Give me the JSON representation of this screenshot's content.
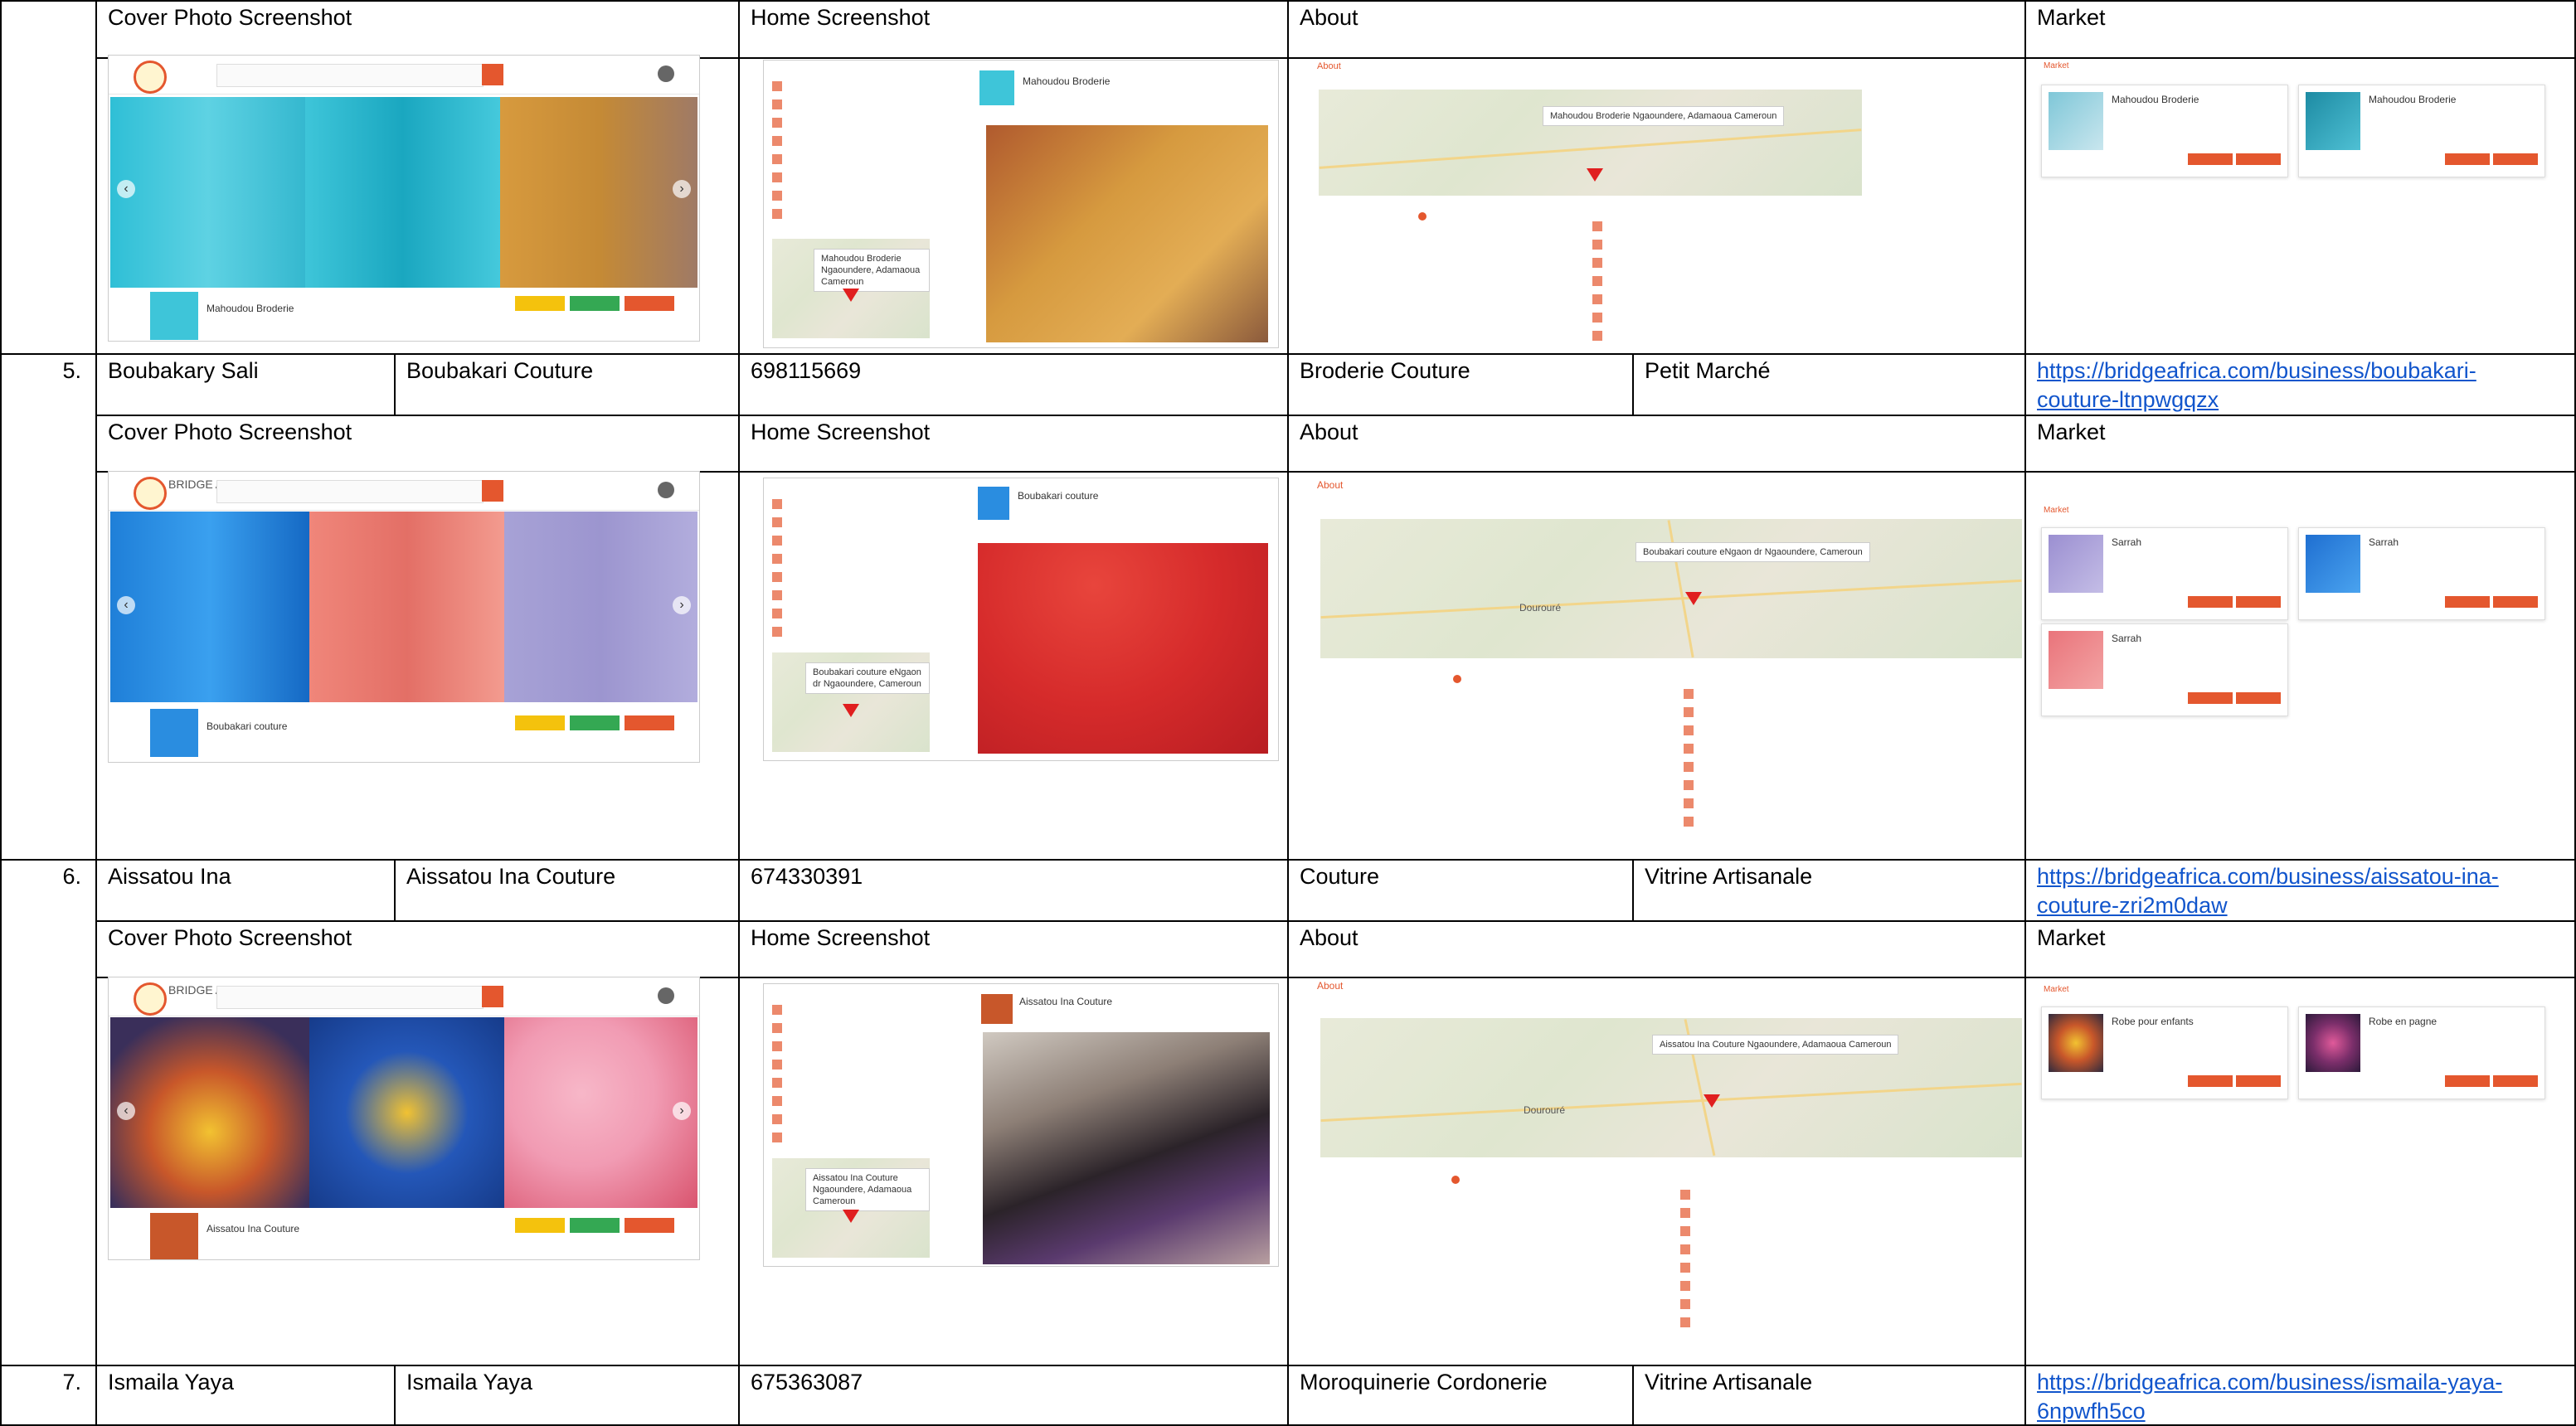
{
  "headers": {
    "cover": "Cover Photo Screenshot",
    "home": "Home Screenshot",
    "about": "About",
    "market": "Market"
  },
  "rows": [
    {
      "number": "5.",
      "name": "Boubakary Sali",
      "business": "Boubakari Couture",
      "phone": "698115669",
      "category": "Broderie Couture",
      "network": "Petit Marché",
      "url": "https://bridgeafrica.com/business/boubakari-couture-ltnpwgqzx"
    },
    {
      "number": "6.",
      "name": "Aissatou Ina",
      "business": "Aissatou Ina Couture",
      "phone": "674330391",
      "category": "Couture",
      "network": "Vitrine Artisanale",
      "url": "https://bridgeafrica.com/business/aissatou-ina-couture-zri2m0daw"
    },
    {
      "number": "7.",
      "name": "Ismaila Yaya",
      "business": "Ismaila Yaya",
      "phone": "675363087",
      "category": "Moroquinerie Cordonerie",
      "network": "Vitrine Artisanale",
      "url": "https://bridgeafrica.com/business/ismaila-yaya-6npwfh5co"
    }
  ],
  "screens": {
    "logo_text": "BRIDGE AFRICA",
    "previous_business": "Mahoudou Broderie",
    "shot1_business": "Boubakari couture",
    "shot1_address": "Boubakari couture eNgaon dr Ngaoundere, Cameroun",
    "shot2_business": "Aissatou Ina Couture",
    "shot2_address": "Aissatou Ina Couture Ngaoundere, Adamaoua Cameroun",
    "prev_address": "Mahoudou Broderie Ngaoundere, Adamaoua Cameroun",
    "map_city": "Dourouré",
    "market_prev": [
      "Mahoudou Broderie",
      "Mahoudou Broderie"
    ],
    "market_shot1": [
      "Sarrah",
      "Sarrah",
      "Sarrah"
    ],
    "market_shot2": [
      "Robe pour enfants",
      "Robe en pagne"
    ],
    "about_label": "About",
    "market_label": "Market"
  },
  "colors": {
    "brand": "#e4572e",
    "link": "#1155cc",
    "yellow_btn": "#f4c20d",
    "green_btn": "#34a853"
  }
}
